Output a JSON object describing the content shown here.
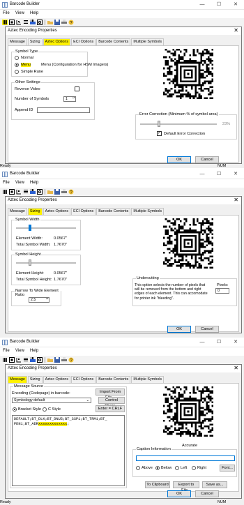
{
  "app": {
    "window_title": "Barcode Builder",
    "menus": [
      "File",
      "View",
      "Help"
    ],
    "window_controls": [
      "—",
      "☐",
      "✕"
    ],
    "status_left": "Ready",
    "status_right": "NUM"
  },
  "dialog": {
    "title": "Aztec Encoding Properties",
    "close": "✕",
    "tabs": [
      "Message",
      "Sizing",
      "Aztec Options",
      "ECI Options",
      "Barcode Contents",
      "Multiple Symbols"
    ],
    "ok": "OK",
    "cancel": "Cancel"
  },
  "toolbar": {
    "icons": [
      "new-barcode-icon",
      "aztec-barcode-icon",
      "datamatrix-icon",
      "pdf417-icon",
      "code128-icon",
      "maxicode-icon",
      "open-icon",
      "save-icon",
      "print-icon",
      "help-icon"
    ],
    "highlighted": [
      "new-barcode-icon"
    ]
  },
  "aztec_options": {
    "active_tab": "Aztec Options",
    "symbol_type_title": "Symbol Type",
    "normal_label": "Normal",
    "menu_label": "Menu (Configuration for HSM Imagers)",
    "menu_word": "Menu",
    "simple_rune_label": "Simple Rune",
    "selected": "Menu",
    "other_settings_title": "Other Settings",
    "reverse_video_label": "Reverse Video",
    "reverse_video_checked": false,
    "num_symbols_label": "Number of Symbols",
    "num_symbols_value": "1",
    "append_id_label": "Append ID",
    "append_id_value": "",
    "error_correction_title": "Error Correction (Minimum % of symbol area)",
    "error_correction_value": "23%",
    "error_correction_level": 0.23,
    "default_ec_label": "Default Error Correction",
    "default_ec_checked": true
  },
  "sizing": {
    "active_tab": "Sizing",
    "symbol_width_title": "Symbol Width",
    "element_width_label": "Element Width:",
    "element_width_value": "0.0567\"",
    "total_width_label": "Total Symbol Width:",
    "total_width_value": "1.7670\"",
    "symbol_height_title": "Symbol Height",
    "element_height_label": "Element Height:",
    "element_height_value": "0.0567\"",
    "total_height_label": "Total Symbol Height:",
    "total_height_value": "1.7670\"",
    "ratio_title": "Narrow To Wide Element Ratio",
    "ratio_value": "2.5",
    "undercutting_title": "Undercutting",
    "undercutting_text": "This option selects the number of pixels that will be removed from the bottom and right edges of each element.  This can accomodate for printer ink \"bleeding\".",
    "pixels_label": "Pixels:",
    "pixels_value": "0"
  },
  "message": {
    "active_tab": "Message",
    "source_title": "Message Source",
    "codepage_label": "Encoding (Codepage) in barcode:",
    "codepage_value": "Symbology default",
    "import_button": "Import From File...",
    "control_chars_button": "Control Chars...",
    "enter_button": "Enter = CRLF",
    "bracket_label": "Bracket Style",
    "c_style_label": "C Style",
    "selected_style": "Bracket Style",
    "message_line1": "DEFAULT;BT_DLK;BT_DNU5;BT_SSP1;BT_TRM1;BT_",
    "message_line2_prefix": "PEN1;BT_ADR",
    "message_line2_highlight": "xxxxxxxxxxxxx",
    "message_line2_suffix": ";",
    "accurate_label": "Accurate",
    "caption_title": "Caption Information",
    "caption_value": "",
    "above_label": "Above",
    "below_label": "Below",
    "left_label": "Left",
    "right_label": "Right",
    "caption_position": "Below",
    "font_button": "Font...",
    "to_clipboard_button": "To Clipboard",
    "export_button": "Export to File...",
    "save_as_button": "Save as..."
  }
}
